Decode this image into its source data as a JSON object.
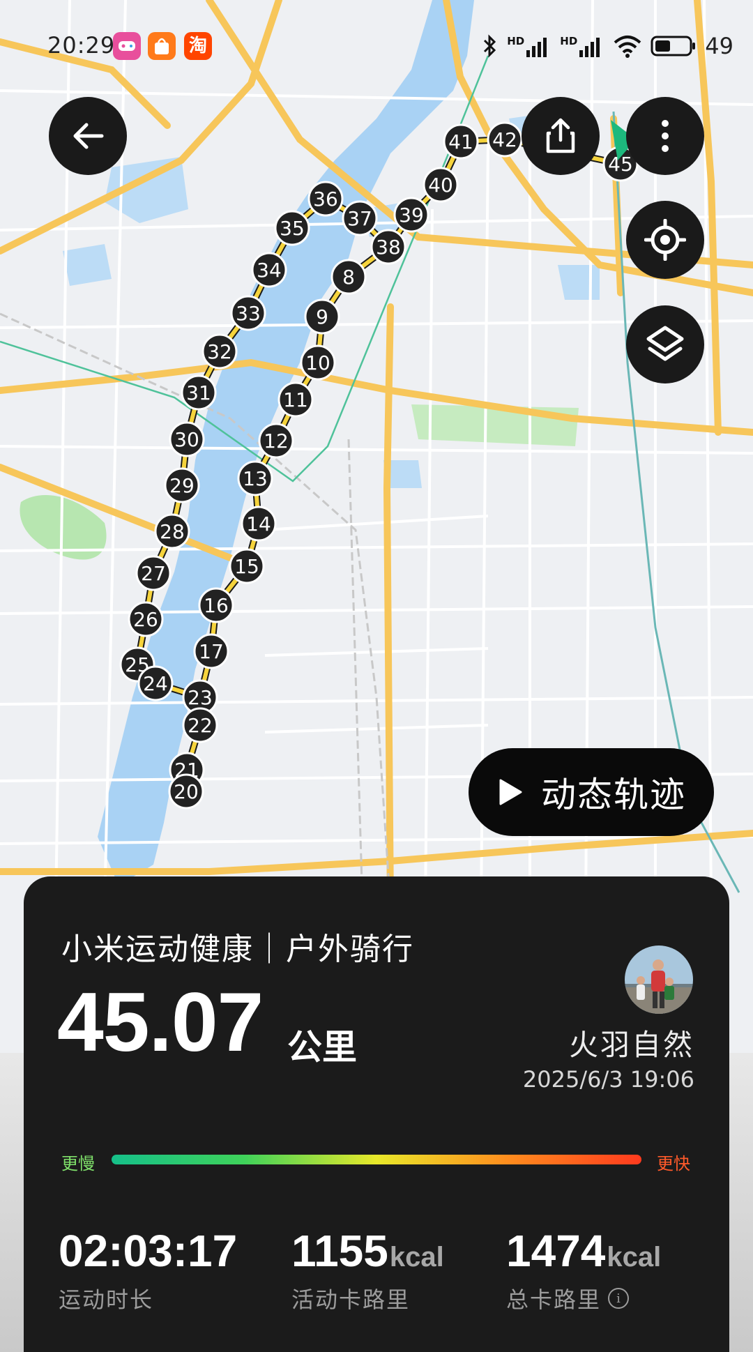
{
  "status_bar": {
    "time": "20:29",
    "apps": [
      {
        "icon": "game-center-icon",
        "color": "#e84f9c"
      },
      {
        "icon": "shopping-bag-icon",
        "color": "#ff7a1a"
      },
      {
        "icon": "taobao-icon",
        "color": "#ff4500",
        "text": "淘"
      }
    ],
    "signal_labels": [
      "HD",
      "HD"
    ],
    "battery_percent": "49"
  },
  "map": {
    "markers": [
      "36",
      "35",
      "37",
      "38",
      "34",
      "8",
      "33",
      "9",
      "32",
      "10",
      "31",
      "11",
      "30",
      "12",
      "29",
      "13",
      "28",
      "14",
      "27",
      "15",
      "26",
      "16",
      "25",
      "17",
      "24",
      "23",
      "22",
      "21",
      "20",
      "39",
      "40",
      "41",
      "42",
      "45"
    ],
    "end_marker_color": "#1db97d",
    "route_color": "#1a1a1a",
    "river_color": "#a9d2f4"
  },
  "controls": {
    "back_icon": "arrow-left-icon",
    "share_icon": "share-icon",
    "more_icon": "more-vertical-icon",
    "locate_icon": "locate-icon",
    "layers_icon": "layers-icon",
    "play_label": "动态轨迹"
  },
  "card": {
    "title": "小米运动健康｜户外骑行",
    "distance": "45.07",
    "distance_unit": "公里",
    "user_name": "火羽自然",
    "datetime": "2025/6/3 19:06",
    "speed_slow": "更慢",
    "speed_fast": "更快",
    "metrics": [
      {
        "value": "02:03:17",
        "unit": "",
        "label": "运动时长"
      },
      {
        "value": "1155",
        "unit": "kcal",
        "label": "活动卡路里"
      },
      {
        "value": "1474",
        "unit": "kcal",
        "label": "总卡路里"
      }
    ]
  }
}
